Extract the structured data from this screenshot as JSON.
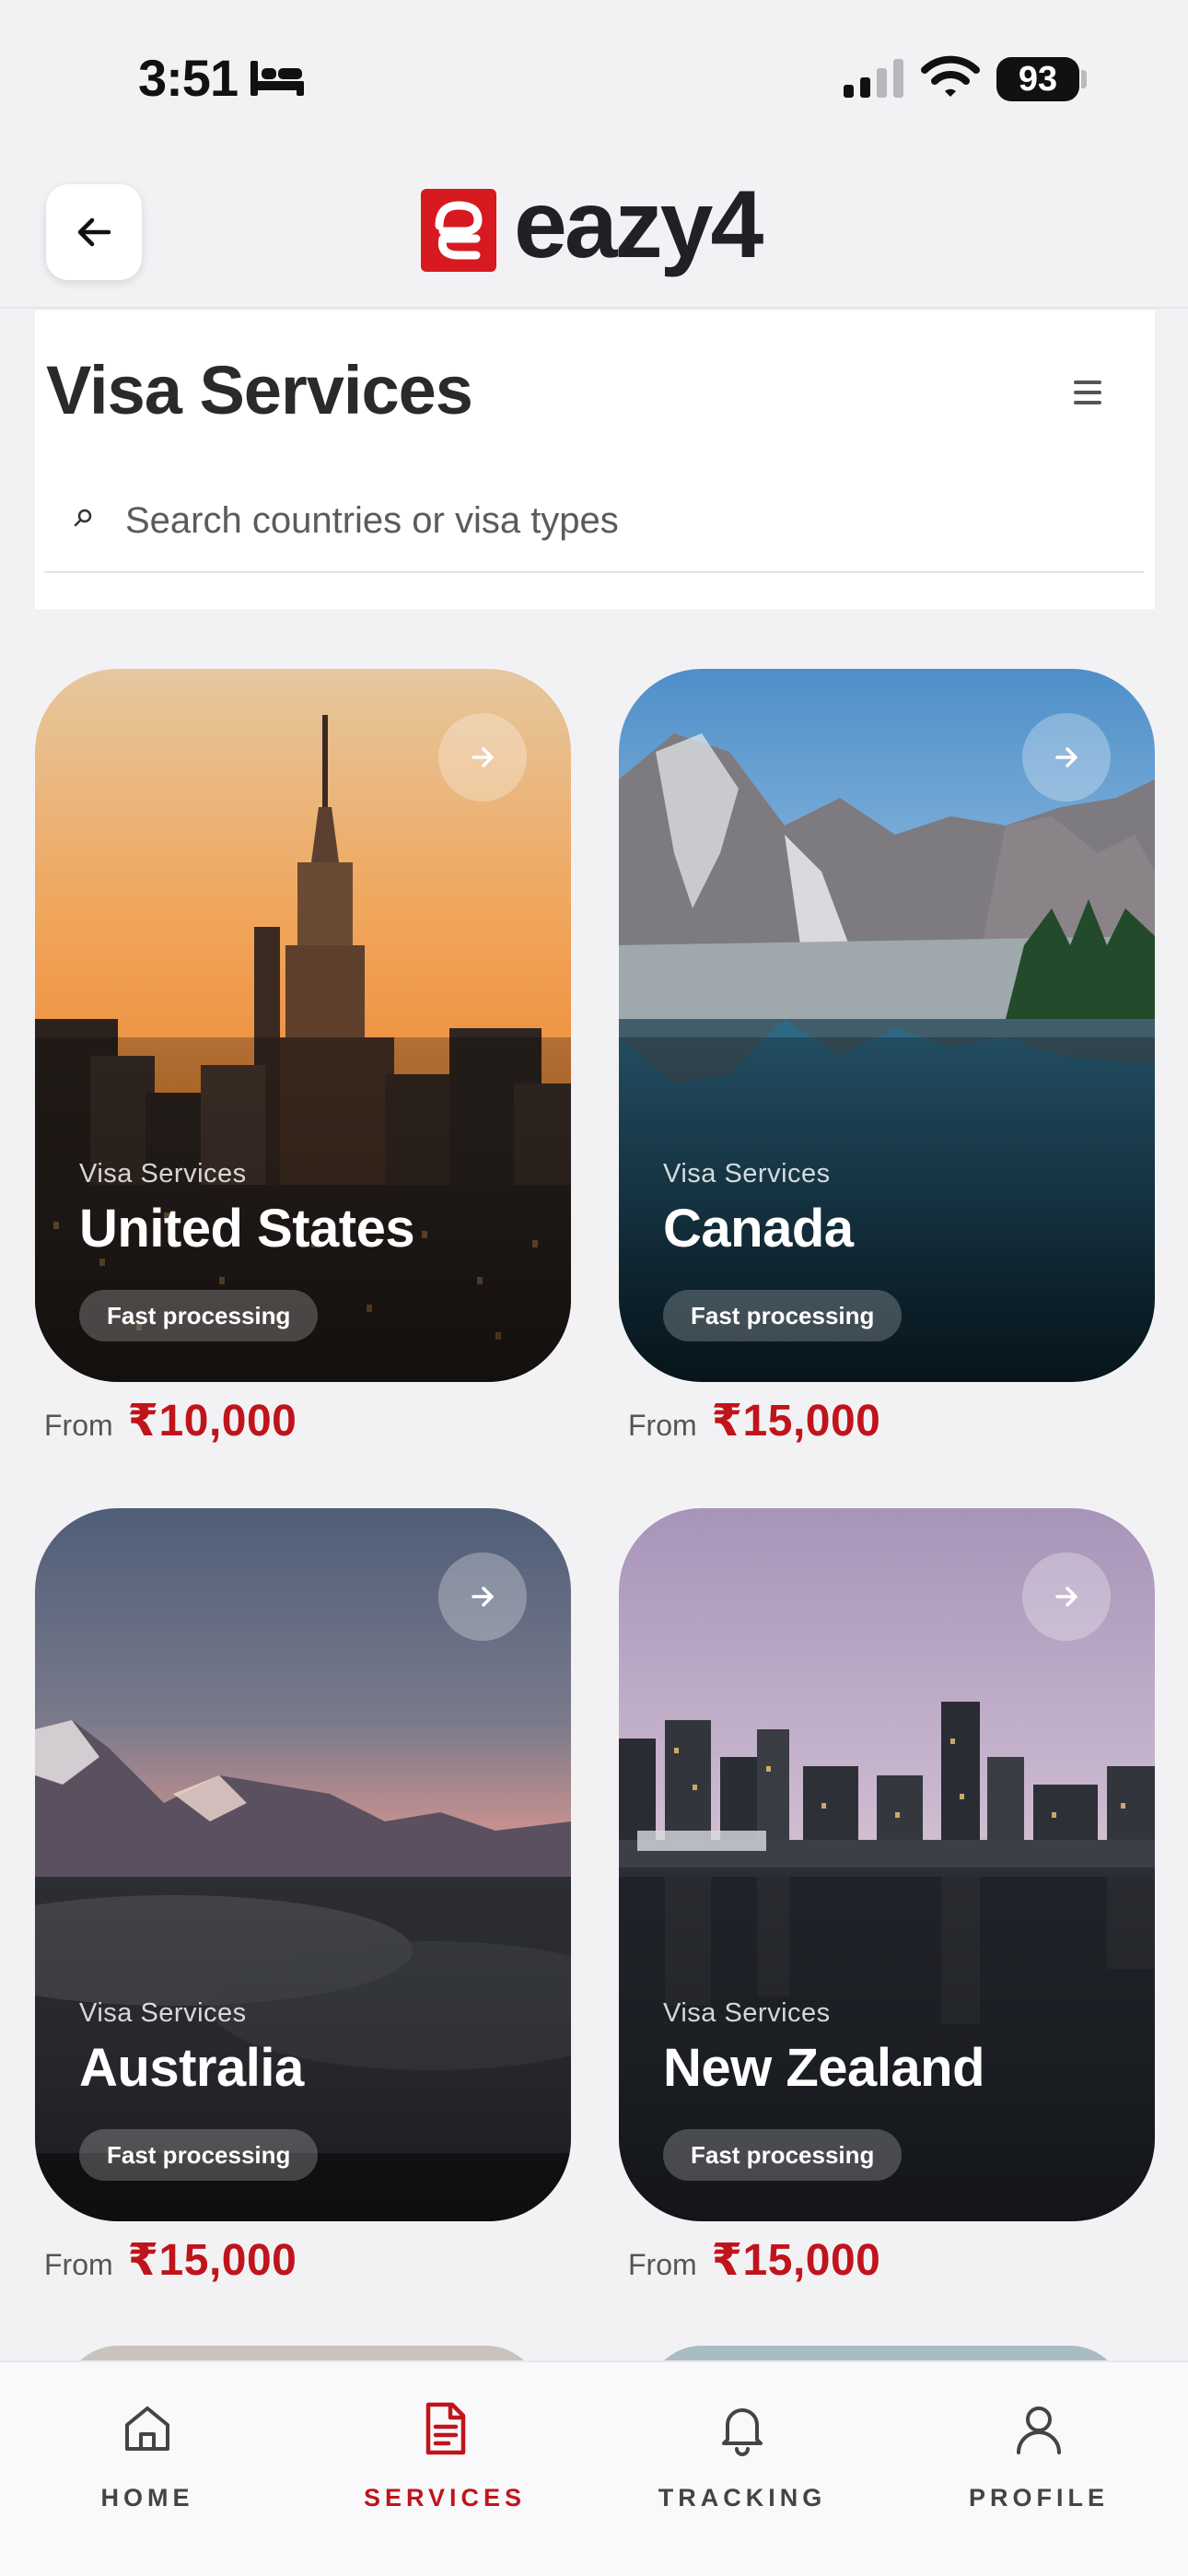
{
  "status_bar": {
    "time": "3:51",
    "battery": "93"
  },
  "header": {
    "logo_text": "eazy4"
  },
  "page": {
    "title": "Visa Services"
  },
  "search": {
    "placeholder": "Search countries or visa types",
    "value": ""
  },
  "cards": [
    {
      "kicker": "Visa Services",
      "country": "United States",
      "badge": "Fast processing",
      "price_prefix": "From",
      "price": "₹10,000"
    },
    {
      "kicker": "Visa Services",
      "country": "Canada",
      "badge": "Fast processing",
      "price_prefix": "From",
      "price": "₹15,000"
    },
    {
      "kicker": "Visa Services",
      "country": "Australia",
      "badge": "Fast processing",
      "price_prefix": "From",
      "price": "₹15,000"
    },
    {
      "kicker": "Visa Services",
      "country": "New Zealand",
      "badge": "Fast processing",
      "price_prefix": "From",
      "price": "₹15,000"
    }
  ],
  "nav": {
    "items": [
      {
        "label": "HOME",
        "icon": "home-icon",
        "active": false
      },
      {
        "label": "SERVICES",
        "icon": "document-icon",
        "active": true
      },
      {
        "label": "TRACKING",
        "icon": "bell-icon",
        "active": false
      },
      {
        "label": "PROFILE",
        "icon": "user-icon",
        "active": false
      }
    ]
  },
  "colors": {
    "accent": "#c0141c",
    "brand": "#d71920",
    "text": "#2a2a2a",
    "background": "#f2f2f5"
  }
}
